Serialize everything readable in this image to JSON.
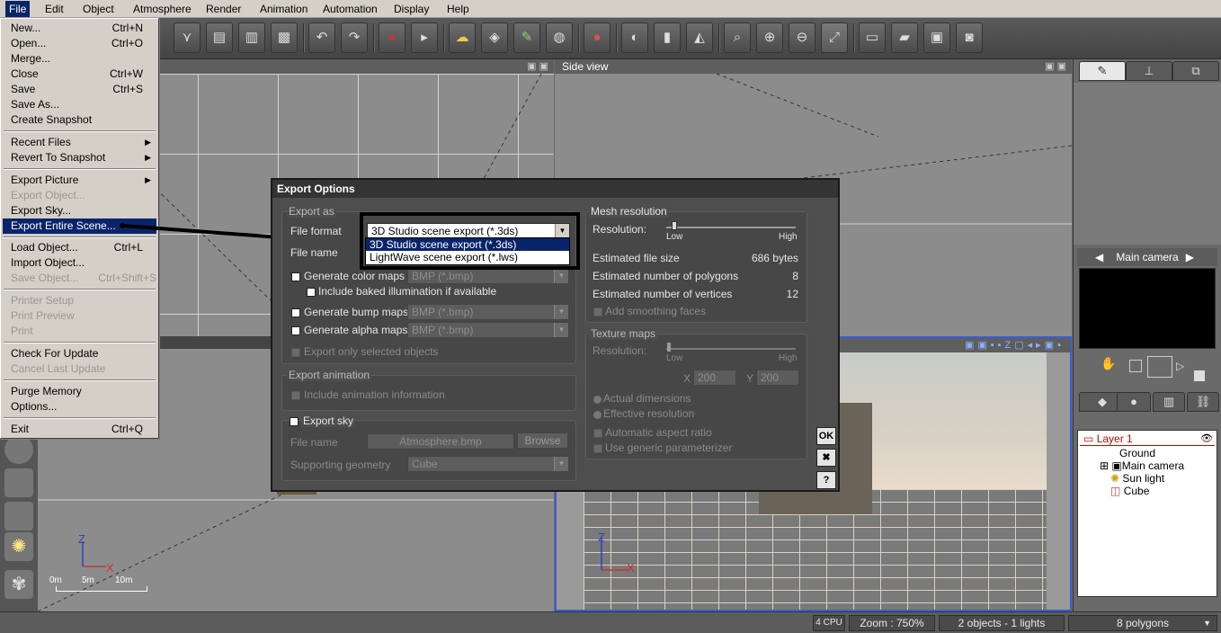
{
  "menubar": {
    "items": [
      "File",
      "Edit",
      "Object",
      "Atmosphere",
      "Render",
      "Animation",
      "Automation",
      "Display",
      "Help"
    ]
  },
  "toolbar": {
    "icons": [
      "cursor-icon",
      "copy-icon",
      "paste-icon",
      "object-icon",
      "undo-icon",
      "redo-icon",
      "render-area-icon",
      "render-icon",
      "sky-icon",
      "object-3d-icon",
      "brush-icon",
      "paint-icon",
      "materials-icon",
      "sphere-icon",
      "bar-icon",
      "mirror-icon",
      "zoom-select-icon",
      "zoom-in-icon",
      "zoom-out-icon",
      "fit-icon",
      "film-icon",
      "clapper-icon",
      "frame-icon",
      "camera-icon"
    ]
  },
  "viewports": {
    "side_title": "Side view"
  },
  "file_menu": {
    "items": [
      {
        "label": "New...",
        "shortcut": "Ctrl+N",
        "disabled": false
      },
      {
        "label": "Open...",
        "shortcut": "Ctrl+O",
        "disabled": false
      },
      {
        "label": "Merge...",
        "shortcut": "",
        "disabled": false
      },
      {
        "label": "Close",
        "shortcut": "Ctrl+W",
        "disabled": false
      },
      {
        "label": "Save",
        "shortcut": "Ctrl+S",
        "disabled": false
      },
      {
        "label": "Save As...",
        "shortcut": "",
        "disabled": false
      },
      {
        "label": "Create Snapshot",
        "shortcut": "",
        "disabled": false
      },
      {
        "label": "Recent Files",
        "shortcut": "",
        "disabled": false,
        "submenu": true
      },
      {
        "label": "Revert To Snapshot",
        "shortcut": "",
        "disabled": false,
        "submenu": true
      },
      {
        "label": "Export Picture",
        "shortcut": "",
        "disabled": false,
        "submenu": true
      },
      {
        "label": "Export Object...",
        "shortcut": "",
        "disabled": true
      },
      {
        "label": "Export Sky...",
        "shortcut": "",
        "disabled": false
      },
      {
        "label": "Export Entire Scene...",
        "shortcut": "",
        "disabled": false,
        "highlighted": true
      },
      {
        "label": "Load Object...",
        "shortcut": "Ctrl+L",
        "disabled": false
      },
      {
        "label": "Import Object...",
        "shortcut": "",
        "disabled": false
      },
      {
        "label": "Save Object...",
        "shortcut": "Ctrl+Shift+S",
        "disabled": true
      },
      {
        "label": "Printer Setup",
        "shortcut": "",
        "disabled": true
      },
      {
        "label": "Print Preview",
        "shortcut": "",
        "disabled": true
      },
      {
        "label": "Print",
        "shortcut": "",
        "disabled": true
      },
      {
        "label": "Check For Update",
        "shortcut": "",
        "disabled": false
      },
      {
        "label": "Cancel Last Update",
        "shortcut": "",
        "disabled": true
      },
      {
        "label": "Purge Memory",
        "shortcut": "",
        "disabled": false
      },
      {
        "label": "Options...",
        "shortcut": "",
        "disabled": false
      },
      {
        "label": "Exit",
        "shortcut": "Ctrl+Q",
        "disabled": false
      }
    ]
  },
  "dialog": {
    "title": "Export Options",
    "export_as": {
      "title": "Export as",
      "file_format_label": "File format",
      "file_format_value": "3D Studio scene export (*.3ds)",
      "file_format_options": [
        "3D Studio scene export (*.3ds)",
        "LightWave scene export (*.lws)"
      ],
      "file_name_label": "File name",
      "gen_color_maps": "Generate color maps",
      "color_maps_format": "BMP (*.bmp)",
      "include_baked": "Include baked illumination if available",
      "gen_bump_maps": "Generate bump maps",
      "bump_maps_format": "BMP (*.bmp)",
      "gen_alpha_maps": "Generate alpha maps",
      "alpha_maps_format": "BMP (*.bmp)",
      "export_selected": "Export only selected objects"
    },
    "export_animation": {
      "title": "Export animation",
      "include_animation": "Include animation information"
    },
    "export_sky": {
      "label": "Export sky",
      "file_name_label": "File name",
      "file_name_value": "Atmosphere.bmp",
      "browse": "Browse",
      "supporting_geometry_label": "Supporting geometry",
      "supporting_geometry_value": "Cube"
    },
    "mesh_resolution": {
      "title": "Mesh resolution",
      "resolution_label": "Resolution:",
      "low": "Low",
      "high": "High",
      "estimated_file_size_label": "Estimated file size",
      "estimated_file_size": "686 bytes",
      "estimated_polygons_label": "Estimated number of polygons",
      "estimated_polygons": "8",
      "estimated_vertices_label": "Estimated number of vertices",
      "estimated_vertices": "12",
      "add_smoothing": "Add smoothing faces"
    },
    "texture_maps": {
      "title": "Texture maps",
      "resolution_label": "Resolution:",
      "low": "Low",
      "high": "High",
      "x_label": "X",
      "x_value": "200",
      "y_label": "Y",
      "y_value": "200",
      "actual_dimensions": "Actual dimensions",
      "effective_resolution": "Effective resolution",
      "auto_aspect": "Automatic aspect ratio",
      "generic_param": "Use generic parameterizer"
    },
    "buttons": {
      "ok": "OK",
      "close": "✖",
      "help": "?"
    }
  },
  "right_panel": {
    "camera_label": "Main camera",
    "tree": [
      {
        "label": "Layer 1",
        "indent": 0,
        "color": "#cc0000"
      },
      {
        "label": "Ground",
        "indent": 1
      },
      {
        "label": "Main camera",
        "indent": 1
      },
      {
        "label": "Sun light",
        "indent": 1
      },
      {
        "label": "Cube",
        "indent": 1
      }
    ]
  },
  "axes": {
    "z": "Z",
    "x": "X",
    "scale": [
      "0m",
      "5m",
      "10m"
    ]
  },
  "status": {
    "cpu": "4 CPU",
    "zoom": "Zoom : 750%",
    "objects": "2 objects - 1 lights",
    "polygons": "8 polygons"
  }
}
